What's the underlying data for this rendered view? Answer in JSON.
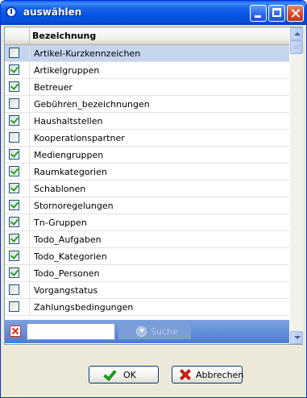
{
  "window": {
    "title": "auswählen",
    "icon": "info-icon"
  },
  "grid": {
    "column_header": "Bezeichnung",
    "items": [
      {
        "label": "Artikel-Kurzkennzeichen",
        "checked": false,
        "selected": true
      },
      {
        "label": "Artikelgruppen",
        "checked": true,
        "selected": false
      },
      {
        "label": "Betreuer",
        "checked": true,
        "selected": false
      },
      {
        "label": "Gebühren_bezeichnungen",
        "checked": false,
        "selected": false
      },
      {
        "label": "Haushaltstellen",
        "checked": true,
        "selected": false
      },
      {
        "label": "Kooperationspartner",
        "checked": false,
        "selected": false
      },
      {
        "label": "Mediengruppen",
        "checked": true,
        "selected": false
      },
      {
        "label": "Raumkategorien",
        "checked": true,
        "selected": false
      },
      {
        "label": "Schablonen",
        "checked": true,
        "selected": false
      },
      {
        "label": "Stornoregelungen",
        "checked": true,
        "selected": false
      },
      {
        "label": "Tn-Gruppen",
        "checked": true,
        "selected": false
      },
      {
        "label": "Todo_Aufgaben",
        "checked": true,
        "selected": false
      },
      {
        "label": "Todo_Kategorien",
        "checked": true,
        "selected": false
      },
      {
        "label": "Todo_Personen",
        "checked": true,
        "selected": false
      },
      {
        "label": "Vorgangstatus",
        "checked": false,
        "selected": false
      },
      {
        "label": "Zahlungsbedingungen",
        "checked": false,
        "selected": false
      }
    ]
  },
  "search": {
    "value": "",
    "placeholder": "",
    "button_label": "Suche"
  },
  "buttons": {
    "ok_label": "OK",
    "cancel_label": "Abbrechen"
  },
  "colors": {
    "selected_row": "#c5d5ee",
    "title_bar": "#0454e2",
    "check_mark": "#21a121"
  }
}
